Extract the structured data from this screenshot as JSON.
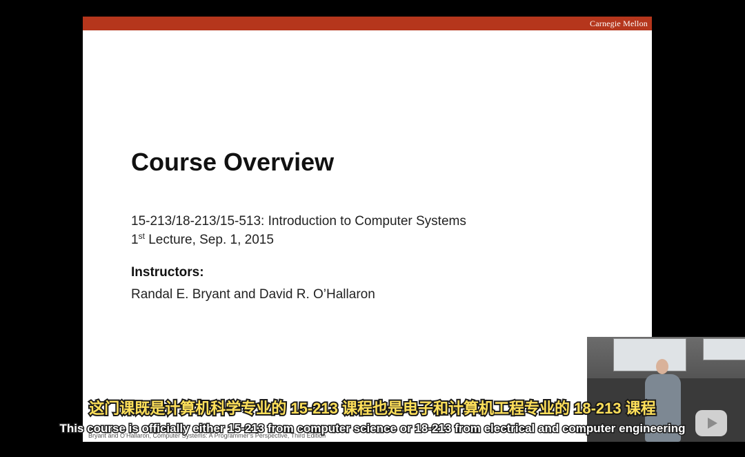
{
  "slide": {
    "brand": "Carnegie Mellon",
    "title": "Course Overview",
    "course_line": "15-213/18-213/15-513: Introduction to Computer Systems",
    "lecture_number": "1",
    "lecture_superscript": "st",
    "lecture_rest": " Lecture, Sep. 1, 2015",
    "instructors_heading": "Instructors:",
    "instructors": "Randal E. Bryant and David R. O’Hallaron",
    "footer": "Bryant and O’Hallaron, Computer Systems: A Programmer’s Perspective, Third Edition",
    "header_color": "#b5361c"
  },
  "subtitles": {
    "zh": "这门课既是计算机科学专业的 15-213 课程也是电子和计算机工程专业的 18-213 课程",
    "en": "This course is officially either 15-213 from computer science or 18-213 from electrical and computer engineering"
  },
  "webcam": {
    "player_icon": "video-player-icon"
  }
}
